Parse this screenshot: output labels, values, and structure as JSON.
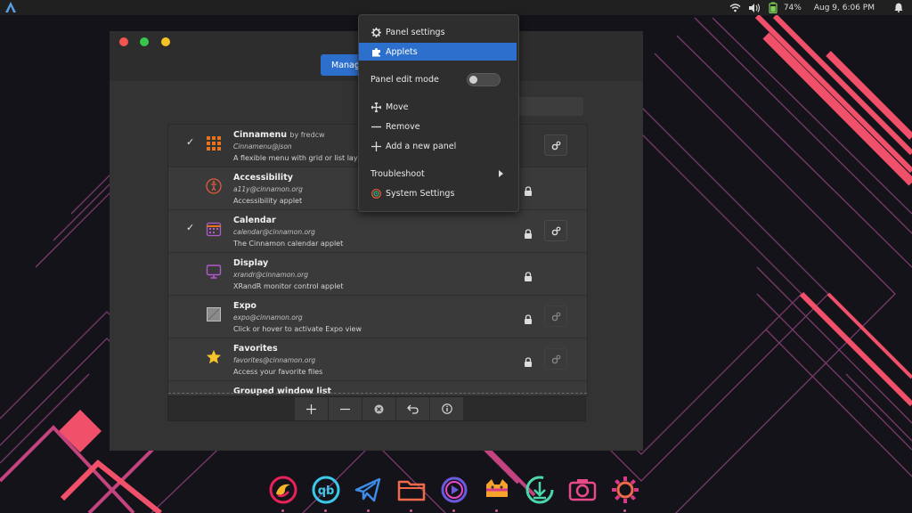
{
  "colors": {
    "panel_bg": "#202020",
    "accent": "#2d6fcc",
    "wallpaper_bg": "#15131a",
    "wallpaper_pink": "#f0506a",
    "wallpaper_magenta": "#c2437e",
    "wallpaper_purple": "#7a3b6d"
  },
  "top_panel": {
    "menu_icon": "cinnamon-menu-icon",
    "tray_icons": [
      "wifi-icon",
      "volume-icon",
      "battery-icon",
      "notifications-icon"
    ],
    "battery_percent": "74%",
    "clock": "Aug  9,  6:06 PM"
  },
  "window": {
    "title_buttons": [
      "close",
      "maximize",
      "minimize"
    ],
    "tab_label": "Manage",
    "applets": [
      {
        "name": "Cinnamenu",
        "author": "by fredcw",
        "uuid": "Cinnamenu@json",
        "description": "A flexible menu with grid or list layout o",
        "checked": true,
        "locked": false,
        "configurable": true,
        "icon": "cinnamenu-grid-icon"
      },
      {
        "name": "Accessibility",
        "author": "",
        "uuid": "a11y@cinnamon.org",
        "description": "Accessibility applet",
        "checked": false,
        "locked": true,
        "configurable": false,
        "icon": "accessibility-icon"
      },
      {
        "name": "Calendar",
        "author": "",
        "uuid": "calendar@cinnamon.org",
        "description": "The Cinnamon calendar applet",
        "checked": true,
        "locked": true,
        "configurable": true,
        "icon": "calendar-icon"
      },
      {
        "name": "Display",
        "author": "",
        "uuid": "xrandr@cinnamon.org",
        "description": "XRandR monitor control applet",
        "checked": false,
        "locked": true,
        "configurable": false,
        "icon": "display-icon"
      },
      {
        "name": "Expo",
        "author": "",
        "uuid": "expo@cinnamon.org",
        "description": "Click or hover to activate Expo view",
        "checked": false,
        "locked": true,
        "configurable": true,
        "icon": "expo-icon"
      },
      {
        "name": "Favorites",
        "author": "",
        "uuid": "favorites@cinnamon.org",
        "description": "Access your favorite files",
        "checked": false,
        "locked": true,
        "configurable": true,
        "icon": "star-icon"
      },
      {
        "name": "Grouped window list",
        "author": "",
        "uuid": "",
        "description": "",
        "checked": false,
        "locked": false,
        "configurable": true,
        "icon": "grouped-window-list-icon"
      }
    ],
    "toolbar": [
      "add-icon",
      "remove-icon",
      "clear-icon",
      "undo-icon",
      "info-icon"
    ]
  },
  "context_menu": {
    "items": [
      {
        "label": "Panel settings",
        "icon": "gear-icon"
      },
      {
        "label": "Applets",
        "icon": "puzzle-icon",
        "active": true
      },
      {
        "label": "Panel edit mode",
        "toggle": false
      },
      {
        "label": "Move",
        "icon": "move-icon"
      },
      {
        "label": "Remove",
        "icon": "minus-icon"
      },
      {
        "label": "Add a new panel",
        "icon": "plus-icon"
      },
      {
        "label": "Troubleshoot",
        "submenu": true
      },
      {
        "label": "System Settings",
        "icon": "system-settings-icon"
      }
    ]
  },
  "dock": {
    "items": [
      "firefox-icon",
      "qbittorrent-icon",
      "telegram-icon",
      "files-icon",
      "media-player-icon",
      "kitty-icon",
      "downloader-icon",
      "camera-icon",
      "settings-icon"
    ],
    "running": [
      true,
      true,
      true,
      true,
      true,
      true,
      false,
      false,
      true
    ]
  }
}
